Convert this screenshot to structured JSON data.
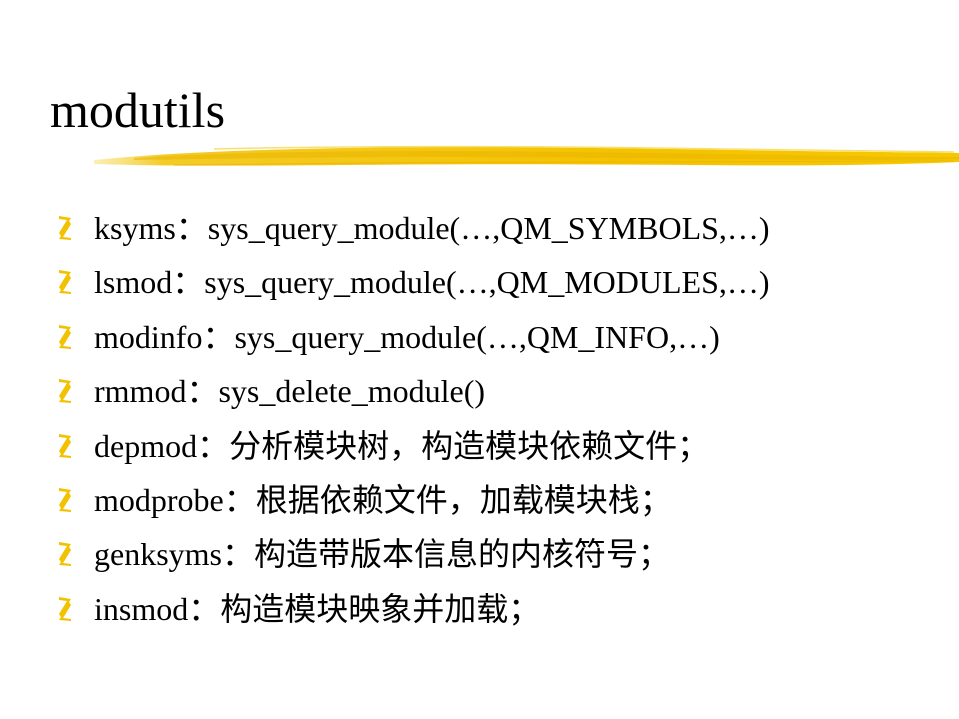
{
  "slide": {
    "title": "modutils",
    "accent_color": "#f2c200",
    "bullet_icon": "yellow-z-bullet-icon",
    "items": [
      {
        "text": "ksyms：sys_query_module(…,QM_SYMBOLS,…)"
      },
      {
        "text": "lsmod：sys_query_module(…,QM_MODULES,…)"
      },
      {
        "text": "modinfo：sys_query_module(…,QM_INFO,…)"
      },
      {
        "text": "rmmod：sys_delete_module()"
      },
      {
        "text": "depmod：分析模块树，构造模块依赖文件；"
      },
      {
        "text": "modprobe：根据依赖文件，加载模块栈；"
      },
      {
        "text": "genksyms：构造带版本信息的内核符号；"
      },
      {
        "text": "insmod：构造模块映象并加载；"
      }
    ]
  }
}
